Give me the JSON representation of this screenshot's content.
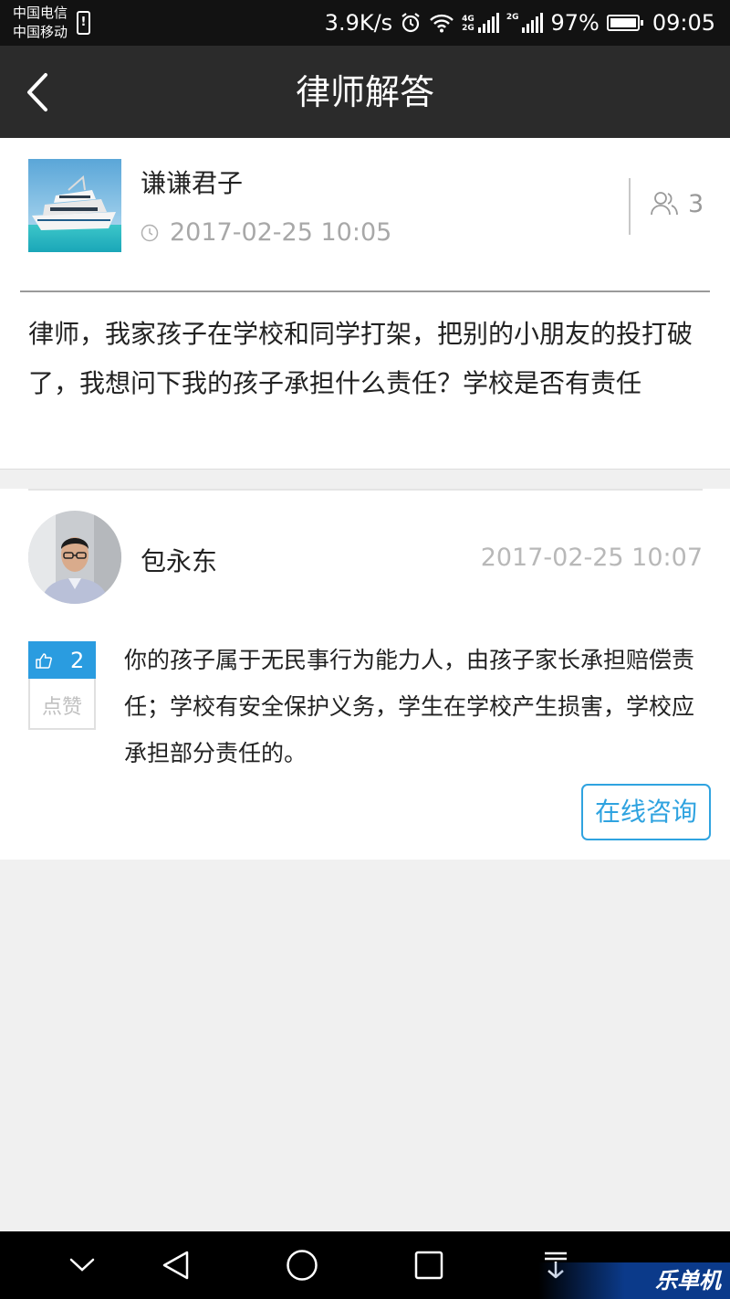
{
  "status_bar": {
    "carrier_1": "中国电信",
    "carrier_2": "中国移动",
    "net_speed": "3.9K/s",
    "net_type_1": "4G",
    "net_type_1b": "2G",
    "net_type_2": "2G",
    "battery": "97%",
    "time": "09:05"
  },
  "nav": {
    "title": "律师解答",
    "back_icon": "chevron-left-icon"
  },
  "question": {
    "asker_name": "谦谦君子",
    "time": "2017-02-25 10:05",
    "viewers": "3",
    "text": "律师，我家孩子在学校和同学打架，把别的小朋友的投打破了，我想问下我的孩子承担什么责任？学校是否有责任"
  },
  "answer": {
    "lawyer_name": "包永东",
    "time": "2017-02-25 10:07",
    "like_count": "2",
    "like_label": "点赞",
    "text": "你的孩子属于无民事行为能力人，由孩子家长承担赔偿责任；学校有安全保护义务，学生在学校产生损害，学校应承担部分责任的。",
    "consult_label": "在线咨询"
  },
  "watermark": "乐单机",
  "colors": {
    "accent": "#2a9ce0",
    "nav_bg": "#2b2b2b",
    "page_bg": "#f0f0f0"
  }
}
